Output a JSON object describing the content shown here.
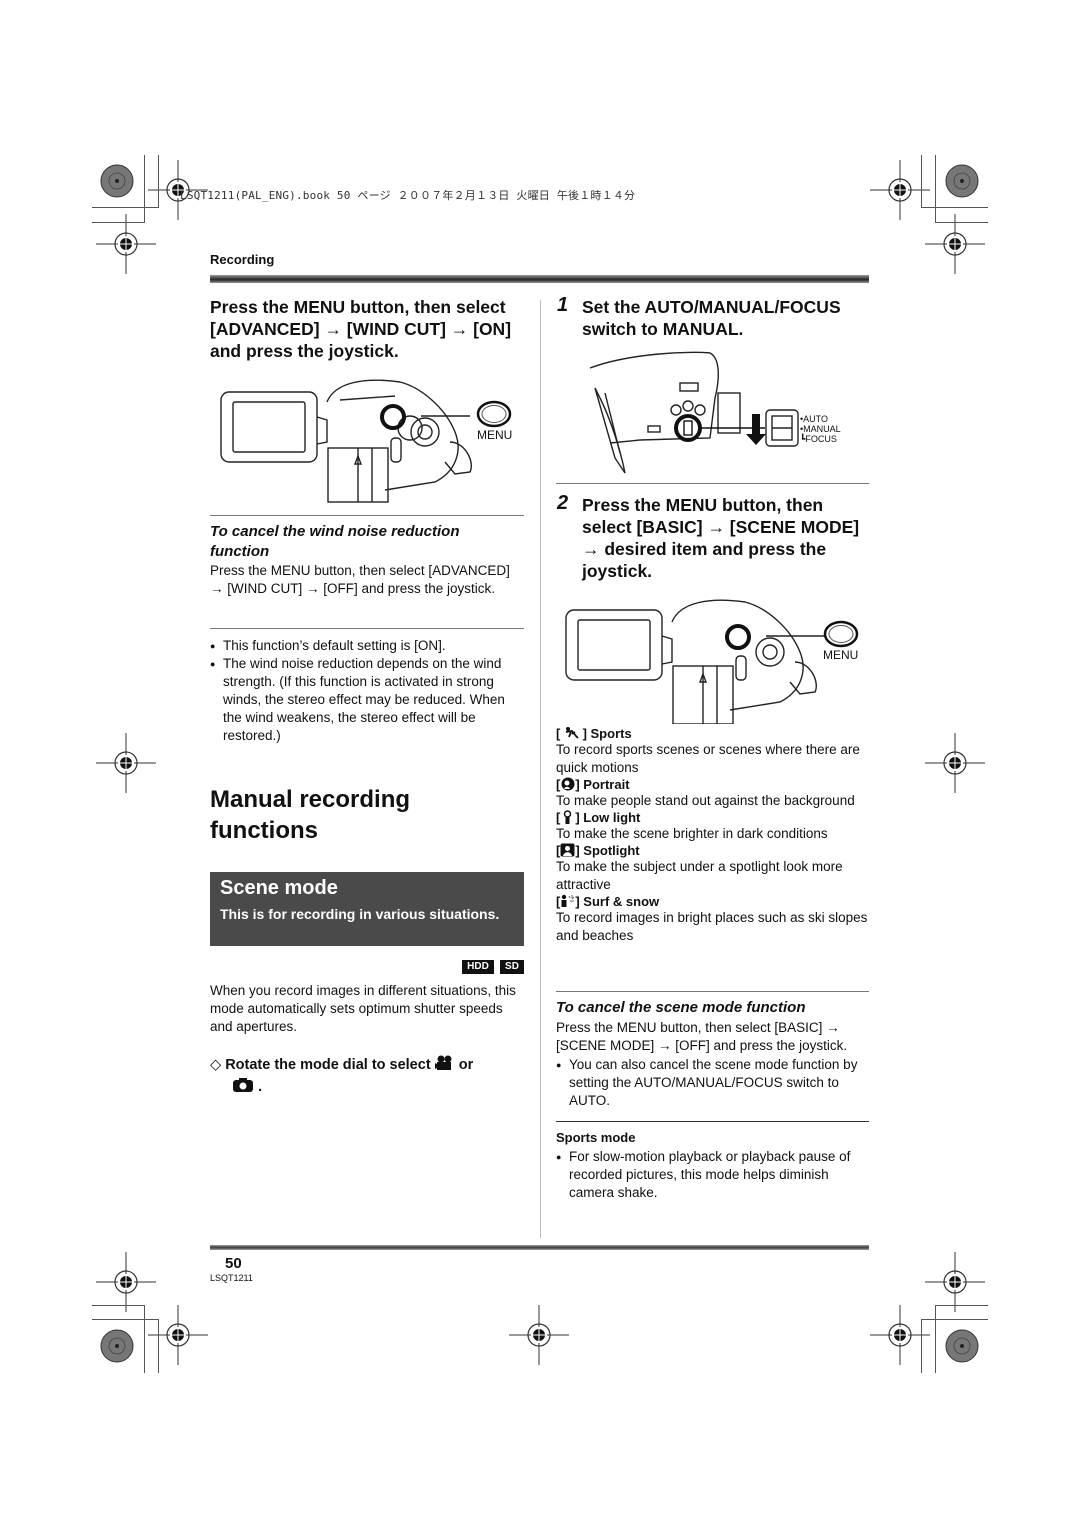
{
  "print_header": "LSQT1211(PAL_ENG).book  50 ページ  ２００７年２月１３日  火曜日  午後１時１４分",
  "section_label": "Recording",
  "left": {
    "step_heading": "Press the MENU button, then select [ADVANCED] → [WIND CUT] → [ON] and press the joystick.",
    "menu_label": "MENU",
    "cancel_heading": "To cancel the wind noise reduction function",
    "cancel_text": "Press the MENU button, then select [ADVANCED] → [WIND CUT] → [OFF] and press the joystick.",
    "notes": [
      "This function’s default setting is [ON].",
      "The wind noise reduction depends on the wind strength. (If this function is activated in strong winds, the stereo effect may be reduced. When the wind weakens, the stereo effect will be restored.)"
    ],
    "chapter_title": "Manual recording functions",
    "scene_box": {
      "title": "Scene mode",
      "subtitle": "This is for recording in various situations."
    },
    "badges": [
      "HDD",
      "SD"
    ],
    "intro_text": "When you record images in different situations, this mode automatically sets optimum shutter speeds and apertures.",
    "dial_instruction_prefix": "Rotate the mode dial to select",
    "dial_instruction_or": "or",
    "dial_instruction_suffix": "."
  },
  "right": {
    "step1": {
      "number": "1",
      "text": "Set the AUTO/MANUAL/FOCUS switch to MANUAL.",
      "switch_labels": [
        "AUTO",
        "MANUAL",
        "FOCUS"
      ]
    },
    "step2": {
      "number": "2",
      "text": "Press the MENU button, then select [BASIC] → [SCENE MODE] → desired item and press the joystick.",
      "menu_label": "MENU"
    },
    "modes": [
      {
        "icon": "sports-icon",
        "name": "Sports",
        "desc": "To record sports scenes or scenes where there are quick motions"
      },
      {
        "icon": "portrait-icon",
        "name": "Portrait",
        "desc": "To make people stand out against the background"
      },
      {
        "icon": "low-light-icon",
        "name": "Low light",
        "desc": "To make the scene brighter in dark conditions"
      },
      {
        "icon": "spotlight-icon",
        "name": "Spotlight",
        "desc": "To make the subject under a spotlight look more attractive"
      },
      {
        "icon": "surf-snow-icon",
        "name": "Surf & snow",
        "desc": "To record images in bright places such as ski slopes and beaches"
      }
    ],
    "cancel_heading": "To cancel the scene mode function",
    "cancel_text": "Press the MENU button, then select [BASIC] → [SCENE MODE] → [OFF] and press the joystick.",
    "cancel_note": "You can also cancel the scene mode function by setting the AUTO/MANUAL/FOCUS switch to AUTO.",
    "sports_mode_heading": "Sports mode",
    "sports_mode_note": "For slow-motion playback or playback pause of recorded pictures, this mode helps diminish camera shake."
  },
  "footer": {
    "page_number": "50",
    "doc_code": "LSQT1211"
  }
}
